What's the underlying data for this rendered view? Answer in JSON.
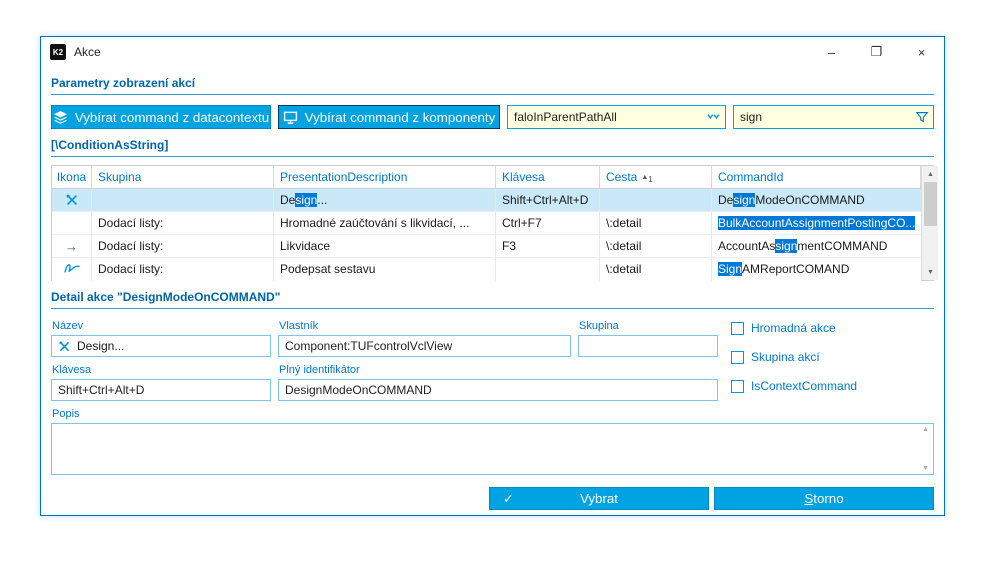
{
  "window": {
    "title": "Akce",
    "logo": "K2",
    "min_glyph": "–",
    "max_glyph": "❐",
    "close_glyph": "×"
  },
  "headers": {
    "params": "Parametry zobrazení akcí",
    "condition": "[\\ConditionAsString]",
    "detail": "Detail akce \"DesignModeOnCOMMAND\""
  },
  "toolbar": {
    "datacontext_btn": "Vybírat command z datacontextu",
    "component_btn": "Vybírat command z komponenty",
    "parent_path_value": "faloInParentPathAll",
    "filter_value": "sign"
  },
  "icons": {
    "up": "▲",
    "down": "▼",
    "sort_asc": "▲",
    "arrow_right": "→",
    "check": "✓"
  },
  "table": {
    "columns": [
      "Ikona",
      "Skupina",
      "PresentationDescription",
      "Klávesa",
      "Cesta",
      "CommandId"
    ],
    "sort_index": "1",
    "rows": [
      {
        "icon": "design-tools-icon",
        "skupina": "",
        "desc_pre": "De",
        "desc_match": "sign",
        "desc_post": "...",
        "klavesa": "Shift+Ctrl+Alt+D",
        "cesta": "",
        "cmd_pre": "De",
        "cmd_match": "sign",
        "cmd_post": "ModeOnCOMMAND"
      },
      {
        "icon": "",
        "skupina": "Dodací listy:",
        "desc_pre": "Hromadné zaúčtování s likvidací, ...",
        "desc_match": "",
        "desc_post": "",
        "klavesa": "Ctrl+F7",
        "cesta": "\\:detail",
        "cmd_pre": "",
        "cmd_match": "BulkAccountAssignmentPostingCO...",
        "cmd_post": ""
      },
      {
        "icon": "arrow-right-icon",
        "skupina": "Dodací listy:",
        "desc_pre": "Likvidace",
        "desc_match": "",
        "desc_post": "",
        "klavesa": "F3",
        "cesta": "\\:detail",
        "cmd_pre": "AccountAs",
        "cmd_match": "sign",
        "cmd_post": "mentCOMMAND"
      },
      {
        "icon": "signature-icon",
        "skupina": "Dodací listy:",
        "desc_pre": "Podepsat sestavu",
        "desc_match": "",
        "desc_post": "",
        "klavesa": "",
        "cesta": "\\:detail",
        "cmd_pre": "",
        "cmd_match": "Sign",
        "cmd_post": "AMReportCOMAND"
      }
    ]
  },
  "detail": {
    "nazev_label": "Název",
    "nazev_value": "Design...",
    "vlastnik_label": "Vlastník",
    "vlastnik_value": "Component:TUFcontrolVclView",
    "skupina_label": "Skupina",
    "skupina_value": "",
    "klavesa_label": "Klávesa",
    "klavesa_value": "Shift+Ctrl+Alt+D",
    "plny_label": "Plný identifikátor",
    "plny_value": "DesignModeOnCOMMAND",
    "popis_label": "Popis",
    "popis_value": "",
    "checkboxes": [
      {
        "label": "Hromadná akce",
        "checked": false
      },
      {
        "label": "Skupina akcí",
        "checked": false
      },
      {
        "label": "IsContextCommand",
        "checked": false
      }
    ]
  },
  "footer": {
    "vybrat_label": "Vybrat",
    "storno_initial": "S",
    "storno_rest": "torno"
  },
  "colors": {
    "accent_cyan": "#00A3E1",
    "highlight_blue": "#0078D7",
    "header_blue": "#0065A9",
    "input_yellow": "#FFFFE1",
    "selected_row": "#C9E8F8"
  }
}
